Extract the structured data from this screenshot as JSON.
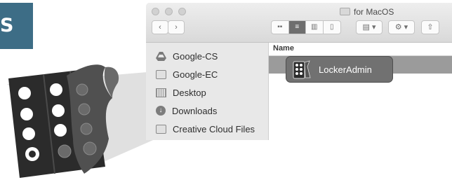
{
  "badge": {
    "text": "S",
    "color": "#3d6d86"
  },
  "window": {
    "title": "for MacOS",
    "traffic_lights": [
      "close",
      "minimize",
      "zoom"
    ],
    "toolbar": {
      "back_icon": "chevron-left-icon",
      "forward_icon": "chevron-right-icon",
      "view_modes": [
        "icon-view",
        "list-view",
        "column-view",
        "cover-flow-view"
      ],
      "active_view": "list-view",
      "group_icon": "group-by-icon",
      "action_icon": "gear-icon",
      "share_icon": "share-icon"
    }
  },
  "sidebar": {
    "items": [
      {
        "label": "Google-CS",
        "icon": "google-drive-icon"
      },
      {
        "label": "Google-EC",
        "icon": "folder-icon"
      },
      {
        "label": "Desktop",
        "icon": "desktop-icon"
      },
      {
        "label": "Downloads",
        "icon": "downloads-icon"
      },
      {
        "label": "Creative Cloud Files",
        "icon": "folder-icon"
      }
    ]
  },
  "list": {
    "column_name": "Name",
    "selected_item": {
      "label": "LockerAdmin",
      "icon": "locker-admin-app-icon"
    }
  },
  "illustration": {
    "icon": "keypad-lock-icon"
  }
}
